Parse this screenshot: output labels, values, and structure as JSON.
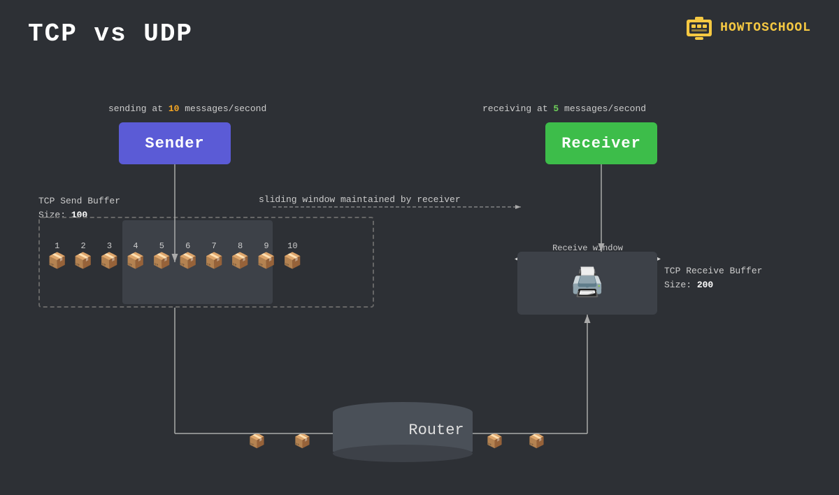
{
  "title": "TCP  vs  UDP",
  "logo": {
    "text": "HOWTOSCHOOL"
  },
  "sender": {
    "label_prefix": "sending at ",
    "rate_number": "10",
    "label_suffix": " messages/second",
    "box_label": "Sender"
  },
  "receiver": {
    "label_prefix": "receiving at ",
    "rate_number": "5",
    "label_suffix": " messages/second",
    "box_label": "Receiver"
  },
  "send_buffer": {
    "label_line1": "TCP Send Buffer",
    "label_line2": "Size: ",
    "size_value": "100"
  },
  "receive_buffer": {
    "label_line1": "TCP Receive Buffer",
    "label_line2": "Size: ",
    "size_value": "200",
    "window_label": "Receive window"
  },
  "sliding_window": {
    "label": "sliding window maintained by receiver"
  },
  "packages": [
    {
      "number": "1"
    },
    {
      "number": "2"
    },
    {
      "number": "3"
    },
    {
      "number": "4"
    },
    {
      "number": "5"
    },
    {
      "number": "6"
    },
    {
      "number": "7"
    },
    {
      "number": "8"
    },
    {
      "number": "9"
    },
    {
      "number": "10"
    }
  ],
  "router": {
    "label": "Router"
  },
  "colors": {
    "background": "#2d3035",
    "sender_box": "#5b5bd6",
    "receiver_box": "#3dbd4a",
    "highlight_orange": "#f5a623",
    "highlight_green": "#6fcf5a",
    "logo_yellow": "#f5c842",
    "buffer_dark": "#3d4148",
    "router_body": "#4a5058"
  }
}
